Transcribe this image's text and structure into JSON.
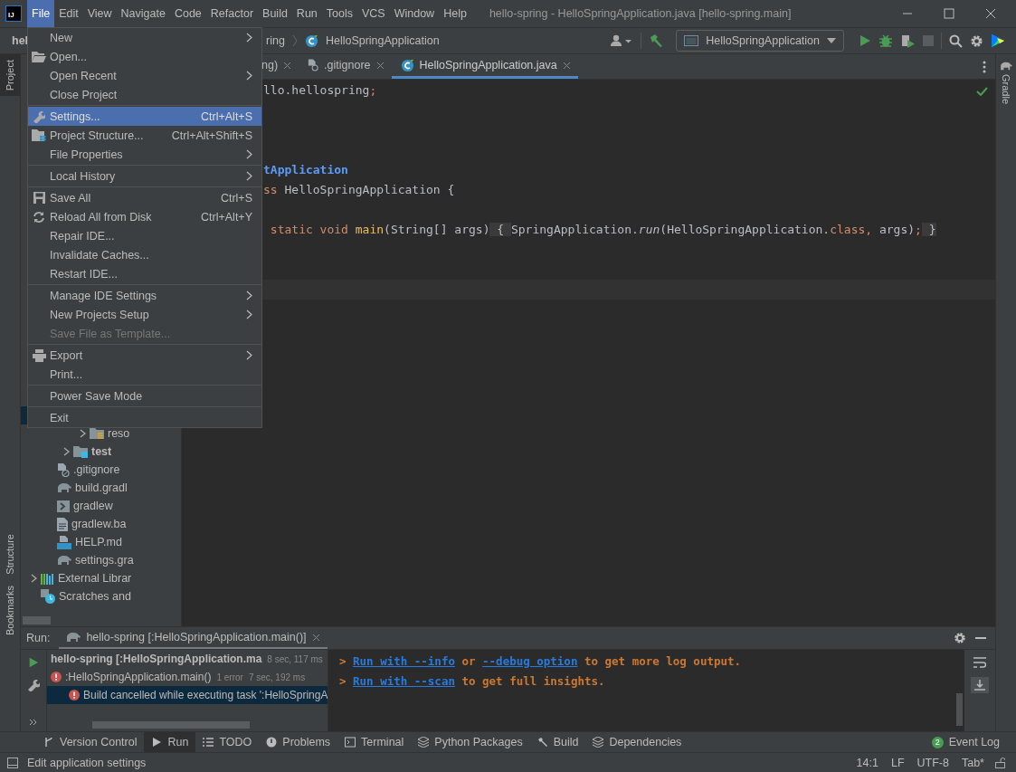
{
  "app_logo": {
    "text": "IJ"
  },
  "menubar": [
    {
      "label": "File",
      "selected": true
    },
    {
      "label": "Edit",
      "selected": false
    },
    {
      "label": "View",
      "selected": false
    },
    {
      "label": "Navigate",
      "selected": false
    },
    {
      "label": "Code",
      "selected": false
    },
    {
      "label": "Refactor",
      "selected": false
    },
    {
      "label": "Build",
      "selected": false
    },
    {
      "label": "Run",
      "selected": false
    },
    {
      "label": "Tools",
      "selected": false
    },
    {
      "label": "VCS",
      "selected": false
    },
    {
      "label": "Window",
      "selected": false
    },
    {
      "label": "Help",
      "selected": false
    }
  ],
  "window_title": "hello-spring - HelloSpringApplication.java [hello-spring.main]",
  "navbar": {
    "project": "hel",
    "breadcrumb": "ring",
    "file": "HelloSpringApplication",
    "run_config": "HelloSpringApplication"
  },
  "left_tool_tabs": [
    {
      "label": "Project",
      "selected": true
    },
    {
      "label": "Structure",
      "selected": false
    },
    {
      "label": "Bookmarks",
      "selected": false
    }
  ],
  "right_tool_tabs": [
    {
      "label": "Gradle",
      "selected": false
    }
  ],
  "editor_tabs": [
    {
      "label": "ng)",
      "selected": false,
      "kind": "cut"
    },
    {
      "label": ".gitignore",
      "selected": false,
      "kind": "ignore"
    },
    {
      "label": "HelloSpringApplication.java",
      "selected": true,
      "kind": "class"
    }
  ],
  "code_lines": [
    {
      "kind": "code",
      "tokens": [
        {
          "kind": "plain",
          "text": "llo.hellospring"
        },
        {
          "kind": "keyword",
          "text": ";"
        }
      ]
    },
    {
      "kind": "blank"
    },
    {
      "kind": "blank"
    },
    {
      "kind": "blank"
    },
    {
      "kind": "code",
      "tokens": [
        {
          "kind": "annotation",
          "text": "tApplication"
        }
      ]
    },
    {
      "kind": "code",
      "tokens": [
        {
          "kind": "keyword",
          "text": "ss "
        },
        {
          "kind": "plain",
          "text": "HelloSpringApplication {"
        }
      ]
    },
    {
      "kind": "blank"
    },
    {
      "kind": "code",
      "tokens": [
        {
          "kind": "keyword",
          "text": " static void "
        },
        {
          "kind": "method",
          "text": "main"
        },
        {
          "kind": "plain",
          "text": "(String[] args)"
        },
        {
          "kind": "fold",
          "text": " { "
        },
        {
          "kind": "plain",
          "text": "SpringApplication."
        },
        {
          "kind": "italic",
          "text": "run"
        },
        {
          "kind": "plain",
          "text": "(HelloSpringApplication."
        },
        {
          "kind": "keyword",
          "text": "class, "
        },
        {
          "kind": "plain",
          "text": "args)"
        },
        {
          "kind": "keyword",
          "text": ";"
        },
        {
          "kind": "fold",
          "text": " }"
        }
      ]
    },
    {
      "kind": "blank"
    },
    {
      "kind": "blank"
    },
    {
      "kind": "blank",
      "current": true
    }
  ],
  "file_menu": [
    [
      {
        "label": "New",
        "submenu": true,
        "selected": false,
        "disabled": false
      },
      {
        "label": "Open...",
        "submenu": false,
        "selected": false,
        "disabled": false
      },
      {
        "label": "Open Recent",
        "submenu": true,
        "selected": false,
        "disabled": false
      },
      {
        "label": "Close Project",
        "submenu": false,
        "selected": false,
        "disabled": false
      }
    ],
    [
      {
        "label": "Settings...",
        "shortcut": "Ctrl+Alt+S",
        "submenu": false,
        "selected": true,
        "disabled": false
      },
      {
        "label": "Project Structure...",
        "shortcut": "Ctrl+Alt+Shift+S",
        "submenu": false,
        "selected": false,
        "disabled": false
      },
      {
        "label": "File Properties",
        "submenu": true,
        "selected": false,
        "disabled": false
      }
    ],
    [
      {
        "label": "Local History",
        "submenu": true,
        "selected": false,
        "disabled": false
      }
    ],
    [
      {
        "label": "Save All",
        "shortcut": "Ctrl+S",
        "submenu": false,
        "selected": false,
        "disabled": false
      },
      {
        "label": "Reload All from Disk",
        "shortcut": "Ctrl+Alt+Y",
        "submenu": false,
        "selected": false,
        "disabled": false
      },
      {
        "label": "Repair IDE...",
        "submenu": false,
        "selected": false,
        "disabled": false
      },
      {
        "label": "Invalidate Caches...",
        "submenu": false,
        "selected": false,
        "disabled": false
      },
      {
        "label": "Restart IDE...",
        "submenu": false,
        "selected": false,
        "disabled": false
      }
    ],
    [
      {
        "label": "Manage IDE Settings",
        "submenu": true,
        "selected": false,
        "disabled": false
      },
      {
        "label": "New Projects Setup",
        "submenu": true,
        "selected": false,
        "disabled": false
      },
      {
        "label": "Save File as Template...",
        "submenu": false,
        "selected": false,
        "disabled": true
      }
    ],
    [
      {
        "label": "Export",
        "submenu": true,
        "selected": false,
        "disabled": false
      },
      {
        "label": "Print...",
        "submenu": false,
        "selected": false,
        "disabled": false
      }
    ],
    [
      {
        "label": "Power Save Mode",
        "submenu": false,
        "selected": false,
        "disabled": false
      }
    ],
    [
      {
        "label": "Exit",
        "submenu": false,
        "selected": false,
        "disabled": false
      }
    ]
  ],
  "project_tree": [
    {
      "children": [
        {
          "children": [
            {
              "children": [
                {
                  "label": "reso",
                  "kind": "resources",
                  "expanded": false
                }
              ]
            },
            {
              "label": "test",
              "kind": "test",
              "expanded": false
            }
          ]
        },
        {
          "label": ".gitignore",
          "kind": "ignore"
        },
        {
          "label": "build.gradl",
          "kind": "gradle"
        },
        {
          "label": "gradlew",
          "kind": "shell"
        },
        {
          "label": "gradlew.ba",
          "kind": "text"
        },
        {
          "label": "HELP.md",
          "kind": "markdown"
        },
        {
          "label": "settings.gra",
          "kind": "gradle"
        }
      ]
    },
    {
      "label": "External Librar",
      "kind": "libraries",
      "expanded": false
    },
    {
      "label": "Scratches and",
      "kind": "scratches"
    }
  ],
  "run_panel": {
    "title": "Run:",
    "tab": "hello-spring [:HelloSpringApplication.main()]",
    "tree": [
      {
        "label": "hello-spring [:HelloSpringApplication.ma",
        "time": "8 sec, 117 ms",
        "bold": true,
        "error": false,
        "selected": false,
        "children": [
          {
            "label": ":HelloSpringApplication.main()",
            "errors": "1 error",
            "time": "7 sec, 192 ms",
            "bold": false,
            "error": true,
            "selected": false,
            "children": [
              {
                "label": "Build cancelled while executing task ':HelloSpringA",
                "bold": false,
                "error": true,
                "selected": true
              }
            ]
          }
        ]
      }
    ],
    "console": [
      [
        {
          "kind": "plain",
          "text": "> "
        },
        {
          "kind": "link",
          "text": "Run with --info"
        },
        {
          "kind": "plain",
          "text": " or "
        },
        {
          "kind": "link",
          "text": "--debug option"
        },
        {
          "kind": "plain",
          "text": " to get more log output."
        }
      ],
      [
        {
          "kind": "plain",
          "text": "> "
        },
        {
          "kind": "link",
          "text": "Run with --scan"
        },
        {
          "kind": "plain",
          "text": " to get full insights."
        }
      ]
    ]
  },
  "bottom_tabs": [
    {
      "label": "Version Control",
      "selected": false
    },
    {
      "label": "Run",
      "selected": true
    },
    {
      "label": "TODO",
      "selected": false
    },
    {
      "label": "Problems",
      "selected": false
    },
    {
      "label": "Terminal",
      "selected": false
    },
    {
      "label": "Python Packages",
      "selected": false
    },
    {
      "label": "Build",
      "selected": false
    },
    {
      "label": "Dependencies",
      "selected": false
    }
  ],
  "event_log": {
    "label": "Event Log",
    "count": "2"
  },
  "status_bar": {
    "message": "Edit application settings",
    "position": "14:1",
    "line_separator": "LF",
    "encoding": "UTF-8",
    "indent": "Tab*"
  }
}
